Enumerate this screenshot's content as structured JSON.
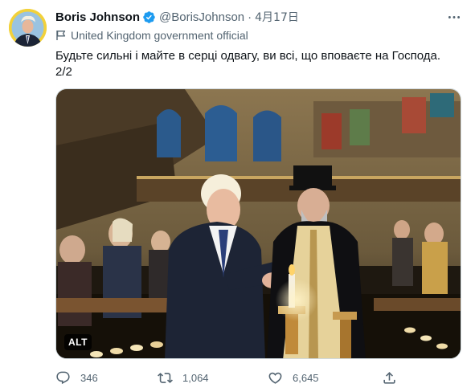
{
  "author": {
    "name": "Boris Johnson",
    "handle": "@BorisJohnson",
    "separator": "·",
    "date": "4月17日",
    "verified": true,
    "avatar_bg": "#f2d13a"
  },
  "account_label": "United Kingdom government official",
  "tweet_text": {
    "line1": "Будьте сильні і майте в серці одвагу, ви всі, що вповаєте на Господа.",
    "line2": "2/2"
  },
  "media": {
    "alt_badge": "ALT"
  },
  "actions": {
    "reply_count": "346",
    "retweet_count": "1,064",
    "like_count": "6,645"
  },
  "colors": {
    "text": "#0f1419",
    "secondary": "#536471",
    "verified": "#1d9bf0",
    "border": "#cfd9de"
  },
  "icons": [
    "verified-badge-icon",
    "more-options-icon",
    "government-flag-icon",
    "reply-icon",
    "retweet-icon",
    "like-icon",
    "share-icon"
  ]
}
